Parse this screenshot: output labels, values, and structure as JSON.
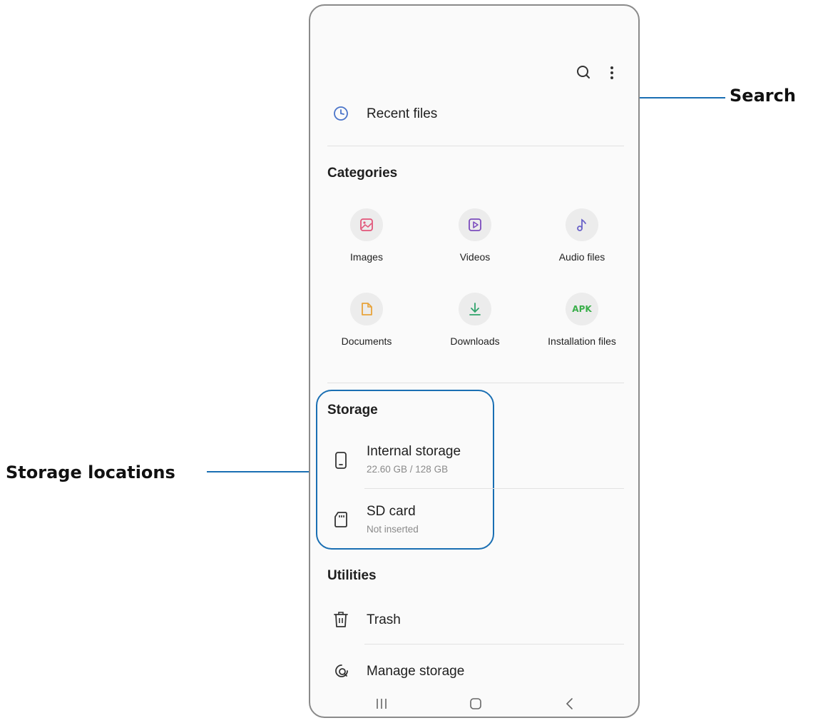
{
  "callouts": {
    "search": "Search",
    "storage_locations": "Storage locations"
  },
  "menu": {
    "recent_files": "Recent files"
  },
  "categories": {
    "title": "Categories",
    "items": [
      {
        "label": "Images",
        "icon": "images-icon",
        "color": "#e2567a"
      },
      {
        "label": "Videos",
        "icon": "videos-icon",
        "color": "#7c4dbd"
      },
      {
        "label": "Audio files",
        "icon": "audio-icon",
        "color": "#6a62c8"
      },
      {
        "label": "Documents",
        "icon": "documents-icon",
        "color": "#e8a33a"
      },
      {
        "label": "Downloads",
        "icon": "downloads-icon",
        "color": "#2fa36b"
      },
      {
        "label": "Installation files",
        "icon": "apk-icon",
        "icon_text": "APK",
        "color": "#3aae4a"
      }
    ]
  },
  "storage": {
    "title": "Storage",
    "items": [
      {
        "label": "Internal storage",
        "sub": "22.60 GB / 128 GB",
        "icon": "phone-icon"
      },
      {
        "label": "SD card",
        "sub": "Not inserted",
        "icon": "sd-card-icon"
      }
    ]
  },
  "utilities": {
    "title": "Utilities",
    "items": [
      {
        "label": "Trash",
        "icon": "trash-icon"
      },
      {
        "label": "Manage storage",
        "icon": "manage-storage-icon"
      }
    ]
  },
  "colors": {
    "callout_line": "#1a6fb3",
    "accent_recent": "#4a74c9"
  }
}
